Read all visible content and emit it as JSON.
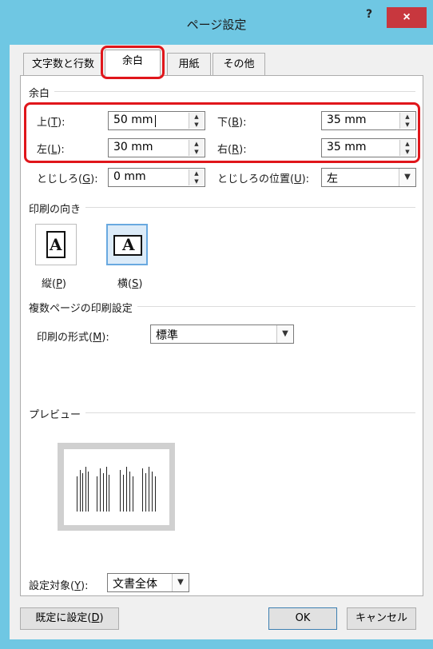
{
  "window": {
    "title": "ページ設定",
    "help_label": "?",
    "close_label": "×"
  },
  "tabs": [
    {
      "label": "文字数と行数",
      "active": false
    },
    {
      "label": "余白",
      "active": true
    },
    {
      "label": "用紙",
      "active": false
    },
    {
      "label": "その他",
      "active": false
    }
  ],
  "margins": {
    "section_label": "余白",
    "top": {
      "label": "上(",
      "key": "T",
      "suffix": "):",
      "value": "50 mm"
    },
    "bottom": {
      "label": "下(",
      "key": "B",
      "suffix": "):",
      "value": "35 mm"
    },
    "left": {
      "label": "左(",
      "key": "L",
      "suffix": "):",
      "value": "30 mm"
    },
    "right": {
      "label": "右(",
      "key": "R",
      "suffix": "):",
      "value": "35 mm"
    },
    "gutter": {
      "label": "とじしろ(",
      "key": "G",
      "suffix": "):",
      "value": "0 mm"
    },
    "gutter_position": {
      "label": "とじしろの位置(",
      "key": "U",
      "suffix": "):",
      "value": "左"
    }
  },
  "orientation": {
    "section_label": "印刷の向き",
    "portrait": {
      "label": "縦(",
      "key": "P",
      "suffix": ")",
      "letter": "A"
    },
    "landscape": {
      "label": "横(",
      "key": "S",
      "suffix": ")",
      "letter": "A"
    },
    "selected": "landscape"
  },
  "multiple_pages": {
    "section_label": "複数ページの印刷設定",
    "label": "印刷の形式(",
    "key": "M",
    "suffix": "):",
    "value": "標準"
  },
  "preview": {
    "section_label": "プレビュー"
  },
  "apply_to": {
    "label": "設定対象(",
    "key": "Y",
    "suffix": "):",
    "value": "文書全体"
  },
  "buttons": {
    "set_default": {
      "label": "既定に設定(",
      "key": "D",
      "suffix": ")"
    },
    "ok": "OK",
    "cancel": "キャンセル"
  },
  "colors": {
    "titlebar": "#6fc7e3",
    "close": "#c8373e",
    "highlight": "#e0161b",
    "selected_border": "#69a9e0"
  }
}
